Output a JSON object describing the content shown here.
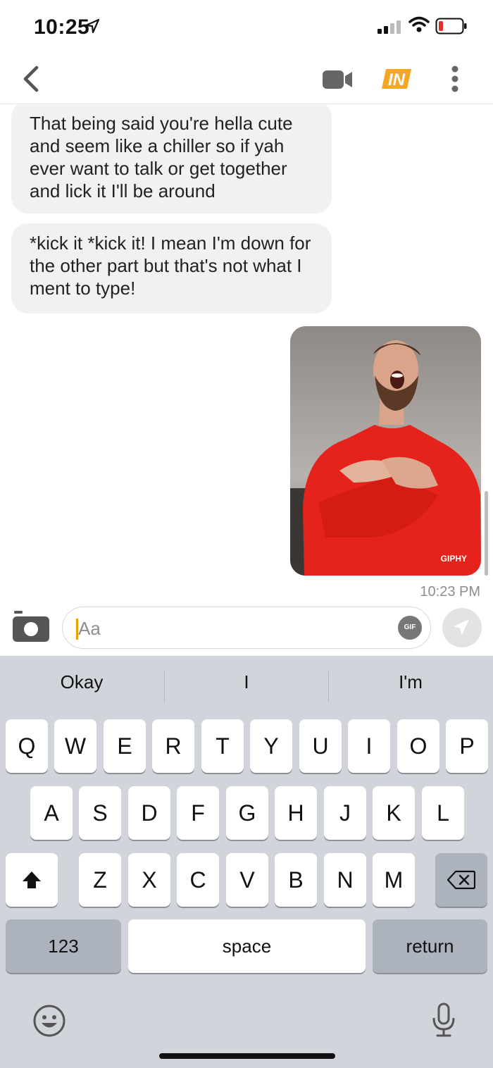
{
  "status_bar": {
    "time": "10:25"
  },
  "nav": {
    "brand": "IN"
  },
  "messages": [
    {
      "text": "That being said you're hella cute and seem like a chiller so if yah ever want to talk or get together and lick it I'll be around"
    },
    {
      "text": "*kick it *kick it! I mean I'm  down for the other part but that's not what I ment to type!"
    }
  ],
  "gif": {
    "badge": "GIPHY"
  },
  "timestamp": "10:23 PM",
  "composer": {
    "placeholder": "Aa",
    "gif_label": "GIF"
  },
  "keyboard": {
    "suggestions": [
      "Okay",
      "I",
      "I'm"
    ],
    "row1": [
      "Q",
      "W",
      "E",
      "R",
      "T",
      "Y",
      "U",
      "I",
      "O",
      "P"
    ],
    "row2": [
      "A",
      "S",
      "D",
      "F",
      "G",
      "H",
      "J",
      "K",
      "L"
    ],
    "row3": [
      "Z",
      "X",
      "C",
      "V",
      "B",
      "N",
      "M"
    ],
    "numbers_label": "123",
    "space_label": "space",
    "return_label": "return"
  },
  "colors": {
    "sweater": "#e5221b",
    "keyboard_bg": "#d1d4da",
    "bubble_bg": "#f1f1f2"
  }
}
